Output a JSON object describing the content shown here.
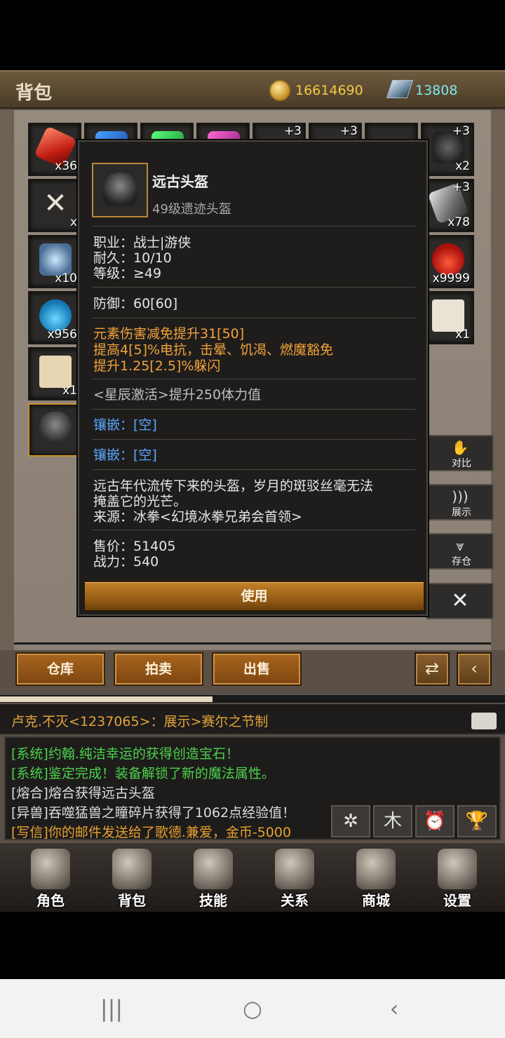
{
  "header": {
    "title": "背包",
    "gold": "16614690",
    "diamonds": "13808"
  },
  "inventory": {
    "slot_counts": [
      "x36",
      "x",
      "x10",
      "x956",
      "x1",
      "x2",
      "x78",
      "x9999",
      "x1"
    ],
    "plus": "+3"
  },
  "tooltip": {
    "name": "远古头盔",
    "subtitle": "49级遗迹头盔",
    "job": "职业：战士|游侠",
    "durability": "耐久：10/10",
    "level": "等级：≥49",
    "defense": "防御：60[60]",
    "bonus1": "元素伤害减免提升31[50]",
    "bonus2": "提高4[5]%电抗，击晕、饥渴、燃魔豁免",
    "bonus3": "提升1.25[2.5]%躲闪",
    "star": "<星辰激活>提升250体力值",
    "socket1": "镶嵌：[空]",
    "socket2": "镶嵌：[空]",
    "desc1": "远古年代流传下来的头盔，岁月的斑驳丝毫无法",
    "desc2": "掩盖它的光芒。",
    "source": "来源：冰拳<幻境冰拳兄弟会首领>",
    "price": "售价：51405",
    "power": "战力：540",
    "use_label": "使用"
  },
  "side_buttons": {
    "compare": "对比",
    "show": "展示",
    "store": "存仓",
    "close": "✕"
  },
  "actions": {
    "warehouse": "仓库",
    "auction": "拍卖",
    "sell": "出售"
  },
  "chat": {
    "header": "卢克.不灭<1237065>：展示>赛尔之节制",
    "lines": [
      "[系统]约翰.纯洁幸运的获得创造宝石！",
      "[系统]鉴定完成！装备解锁了新的魔法属性。",
      "[熔合]熔合获得远古头盔",
      "[异兽]吞噬猛兽之瞳碎片获得了1062点经验值！",
      "[写信]你的邮件发送给了歌德.兼爱，金币-5000"
    ]
  },
  "nav": [
    "角色",
    "背包",
    "技能",
    "关系",
    "商城",
    "设置"
  ],
  "android": {
    "recents": "|||",
    "home": "○",
    "back": "‹"
  }
}
